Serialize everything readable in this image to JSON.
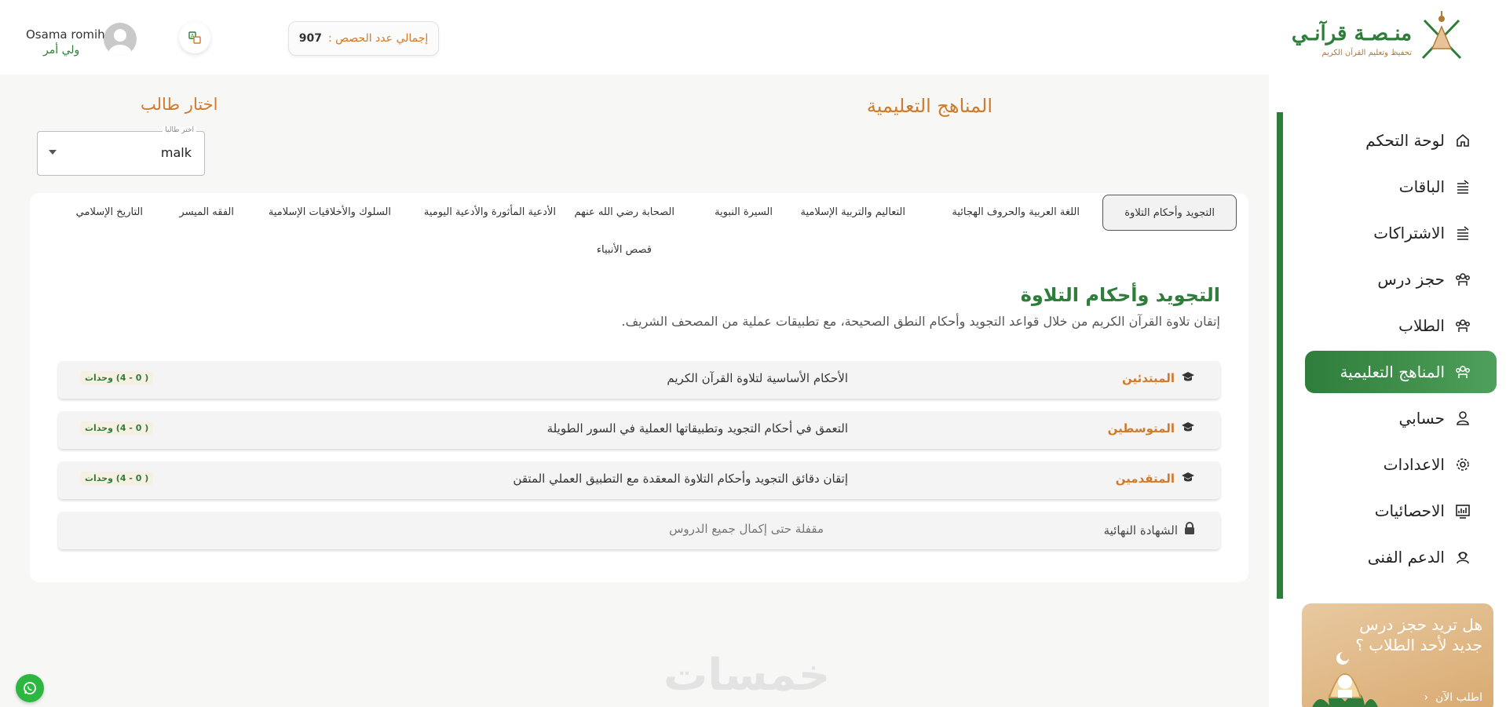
{
  "brand": {
    "name": "منـصـة قرآنـي",
    "tagline": "تحفيظ وتعليم القرآن الكريم"
  },
  "header": {
    "lessons_label": "إجمالي عدد الحصص :",
    "lessons_count": "907",
    "translate_icon": "translate-icon",
    "user_name": "Osama romih",
    "user_role": "ولي أمر"
  },
  "sidebar": {
    "items": [
      {
        "label": "لوحة التحكم",
        "icon": "home-icon",
        "active": false
      },
      {
        "label": "الباقات",
        "icon": "stack-icon",
        "active": false
      },
      {
        "label": "الاشتراكات",
        "icon": "stack-icon",
        "active": false
      },
      {
        "label": "حجز درس",
        "icon": "group-icon",
        "active": false
      },
      {
        "label": "الطلاب",
        "icon": "group-icon",
        "active": false
      },
      {
        "label": "المناهج التعليمية",
        "icon": "group-icon",
        "active": true
      },
      {
        "label": "حسابي",
        "icon": "user-icon",
        "active": false
      },
      {
        "label": "الاعدادات",
        "icon": "gear-icon",
        "active": false
      },
      {
        "label": "الاحصائيات",
        "icon": "stats-icon",
        "active": false
      },
      {
        "label": "الدعم الفنى",
        "icon": "support-icon",
        "active": false
      }
    ],
    "promo": {
      "text": "هل تريد حجز درس جديد لأحد الطلاب ؟",
      "cta": "اطلب الآن"
    }
  },
  "main": {
    "title": "المناهج التعليمية",
    "pick_student_title": "اختار طالب",
    "select": {
      "legend": "اختر طالبا",
      "value": "malk"
    },
    "tabs": [
      "التجويد وأحكام التلاوة",
      "اللغة العربية والحروف الهجائية",
      "التعاليم والتربية الإسلامية",
      "السيرة النبوية",
      "الصحابة رضي الله عنهم",
      "الأدعية المأثورة والأدعية اليومية",
      "السلوك والأخلاقيات الإسلامية",
      "الفقه الميسر",
      "التاريخ الإسلامي",
      "قصص الأنبياء"
    ],
    "section": {
      "title": "التجويد وأحكام التلاوة",
      "description": "إتقان تلاوة القرآن الكريم من خلال قواعد التجويد وأحكام النطق الصحيحة، مع تطبيقات عملية من المصحف الشريف."
    },
    "levels": [
      {
        "name": "المبتدئين",
        "description": "الأحكام الأساسية لتلاوة القرآن الكريم",
        "units": "( 0 - 4) وحدات"
      },
      {
        "name": "المتوسطين",
        "description": "التعمق في أحكام التجويد وتطبيقاتها العملية في السور الطويلة",
        "units": "( 0 - 4) وحدات"
      },
      {
        "name": "المتقدمين",
        "description": "إتقان دقائق التجويد وأحكام التلاوة المعقدة مع التطبيق العملي المتقن",
        "units": "( 0 - 4) وحدات"
      }
    ],
    "certificate": {
      "title": "الشهادة النهائية",
      "description": "مقفلة حتى إكمال جميع الدروس"
    }
  },
  "watermark": "خمسات",
  "colors": {
    "primary_green": "#2f7d3a",
    "accent_orange": "#d07a2c",
    "whatsapp_green": "#2bb741"
  }
}
